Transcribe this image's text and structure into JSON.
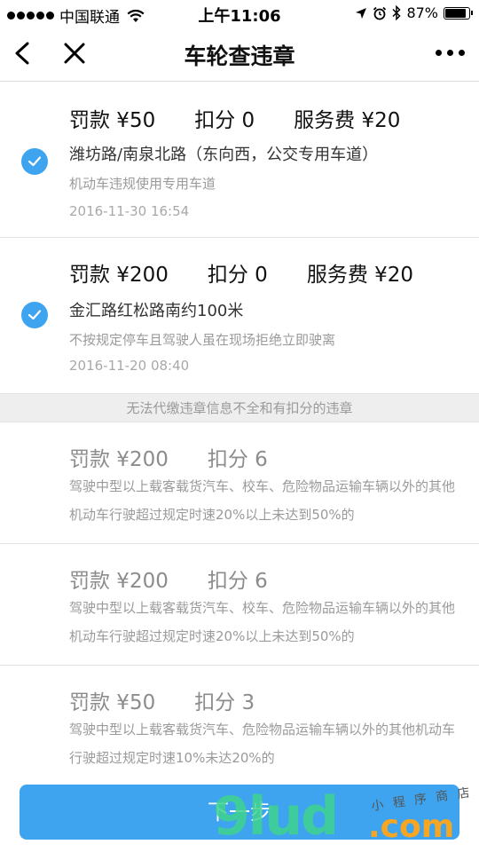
{
  "status_bar": {
    "carrier": "中国联通",
    "time": "上午11:06",
    "battery_text": "87%",
    "battery_level": 0.87
  },
  "nav": {
    "title": "车轮查违章"
  },
  "payable_items": [
    {
      "fine": "罚款 ¥50",
      "points": "扣分 0",
      "service_fee": "服务费 ¥20",
      "location": "潍坊路/南泉北路（东向西，公交专用车道）",
      "description": "机动车违规使用专用车道",
      "date": "2016-11-30 16:54",
      "checked": true
    },
    {
      "fine": "罚款 ¥200",
      "points": "扣分 0",
      "service_fee": "服务费 ¥20",
      "location": "金汇路红松路南约100米",
      "description": "不按规定停车且驾驶人虽在现场拒绝立即驶离",
      "date": "2016-11-20 08:40",
      "checked": true
    }
  ],
  "blocked_section_label": "无法代缴违章信息不全和有扣分的违章",
  "blocked_items": [
    {
      "fine": "罚款 ¥200",
      "points": "扣分 6",
      "description": "驾驶中型以上载客载货汽车、校车、危险物品运输车辆以外的其他机动车行驶超过规定时速20%以上未达到50%的"
    },
    {
      "fine": "罚款 ¥200",
      "points": "扣分 6",
      "description": "驾驶中型以上载客载货汽车、校车、危险物品运输车辆以外的其他机动车行驶超过规定时速20%以上未达到50%的"
    },
    {
      "fine": "罚款 ¥50",
      "points": "扣分 3",
      "description": "驾驶中型以上载客载货汽车、危险物品运输车辆以外的其他机动车行驶超过规定时速10%未达20%的"
    }
  ],
  "next_button_label": "下一步",
  "watermark": {
    "brand": "9lud",
    "domain": ".com",
    "tagline": "小 程 序 商 店"
  },
  "colors": {
    "accent": "#3ea4ef",
    "divider_bg": "#eeeeee",
    "muted_text": "#9a9a9a"
  },
  "icons": {
    "back": "chevron-left-icon",
    "close": "close-icon",
    "more": "more-dots-icon",
    "check": "check-circle-icon",
    "wifi": "wifi-icon",
    "location": "location-arrow-icon",
    "alarm": "alarm-icon",
    "bluetooth": "bluetooth-icon",
    "battery": "battery-icon"
  }
}
